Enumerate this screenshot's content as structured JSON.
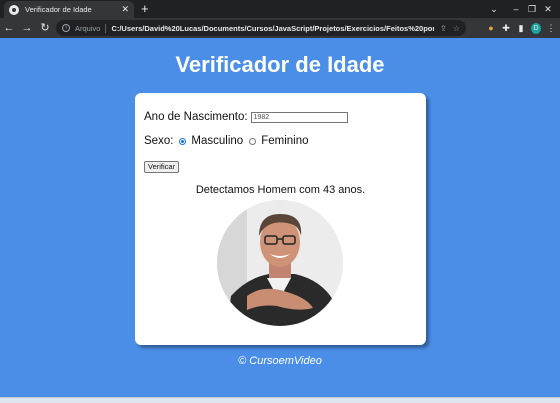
{
  "browser": {
    "tab_title": "Verificador de Idade",
    "new_tab": "+",
    "scheme_label": "Arquivo",
    "url": "C:/Users/David%20Lucas/Documents/Cursos/JavaScript/Projetos/Exercicios/Feitos%20por%...",
    "profile_initial": "D"
  },
  "page": {
    "title": "Verificador de Idade",
    "birth_label": "Ano de Nascimento:",
    "birth_value": "1982",
    "sex_label": "Sexo:",
    "options": [
      "Masculino",
      "Feminino"
    ],
    "selected_option": "Masculino",
    "button_label": "Verificar",
    "result_text": "Detectamos Homem com 43 anos.",
    "footer": "© CursoemVideo"
  },
  "colors": {
    "background": "#4a8ee8",
    "card": "#ffffff"
  }
}
